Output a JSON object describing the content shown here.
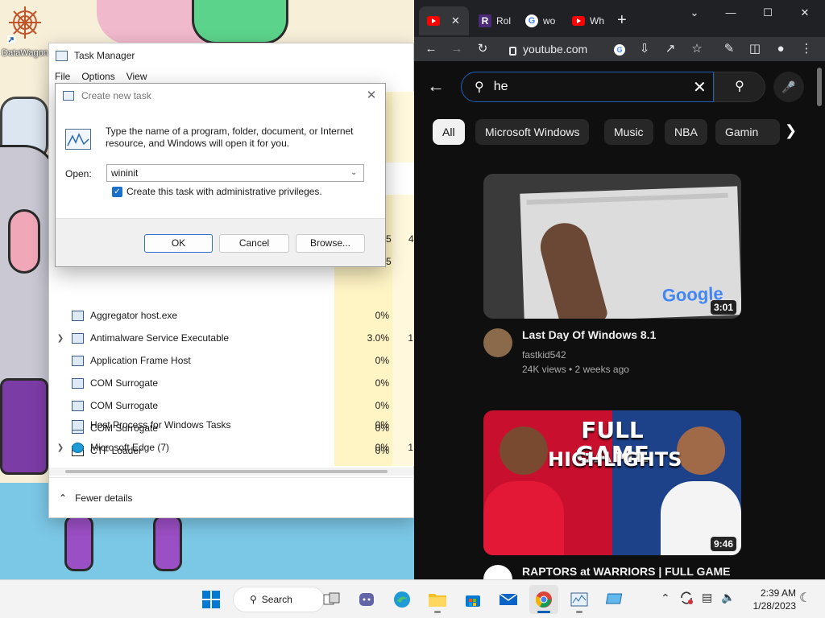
{
  "desktop": {
    "icon_label": "DataWagon"
  },
  "task_manager": {
    "title": "Task Manager",
    "menu": [
      "File",
      "Options",
      "View"
    ],
    "processes": [
      {
        "name": "Aggregator host.exe",
        "cpu": "0%",
        "mem": "",
        "expandable": false
      },
      {
        "name": "Antimalware Service Executable",
        "cpu": "3.0%",
        "mem": "1",
        "expandable": true
      },
      {
        "name": "Application Frame Host",
        "cpu": "0%",
        "mem": "",
        "expandable": false
      },
      {
        "name": "COM Surrogate",
        "cpu": "0%",
        "mem": "",
        "expandable": false
      },
      {
        "name": "COM Surrogate",
        "cpu": "0%",
        "mem": "",
        "expandable": false
      },
      {
        "name": "COM Surrogate",
        "cpu": "0%",
        "mem": "",
        "expandable": false
      },
      {
        "name": "CTF Loader",
        "cpu": "0%",
        "mem": "",
        "expandable": false
      },
      {
        "name": "Host Process for Windows Tasks",
        "cpu": "0%",
        "mem": "",
        "expandable": false
      },
      {
        "name": "Microsoft Edge (7)",
        "cpu": "0%",
        "mem": "1",
        "expandable": true
      }
    ],
    "partial_values": [
      "5",
      "4",
      "5"
    ],
    "footer_label": "Fewer details"
  },
  "dialog": {
    "title": "Create new task",
    "description": "Type the name of a program, folder, document, or Internet resource, and Windows will open it for you.",
    "open_label": "Open:",
    "open_value": "wininit",
    "checkbox_label": "Create this task with administrative privileges.",
    "checkbox_checked": true,
    "ok_label": "OK",
    "cancel_label": "Cancel",
    "browse_label": "Browse..."
  },
  "browser": {
    "tabs": [
      {
        "icon": "youtube-icon",
        "label": "",
        "active": true
      },
      {
        "icon": "roblox-icon",
        "label": "Rol"
      },
      {
        "icon": "google-icon",
        "label": "wo"
      },
      {
        "icon": "youtube-icon",
        "label": "Wh"
      }
    ],
    "url": "youtube.com",
    "search_query": "he",
    "chips": [
      "All",
      "Microsoft Windows",
      "Music",
      "NBA",
      "Gamin"
    ],
    "videos": [
      {
        "title": "Last Day Of Windows 8.1",
        "channel": "fastkid542",
        "meta": "24K views • 2 weeks ago",
        "duration": "3:01",
        "thumb_text": "Google"
      },
      {
        "title": "RAPTORS at WARRIORS | FULL GAME",
        "duration": "9:46",
        "thumb_text_1": "FULL GAME",
        "thumb_text_2": "HIGHLIGHTS"
      }
    ]
  },
  "taskbar": {
    "search_label": "Search",
    "time": "2:39 AM",
    "date": "1/28/2023"
  },
  "colors": {
    "yt_bg": "#0f0f0f",
    "chrome_toolbar": "#35363a",
    "chrome_tabstrip": "#202124",
    "accent": "#005fb8",
    "cpu_highlight": "#fff4c4"
  }
}
